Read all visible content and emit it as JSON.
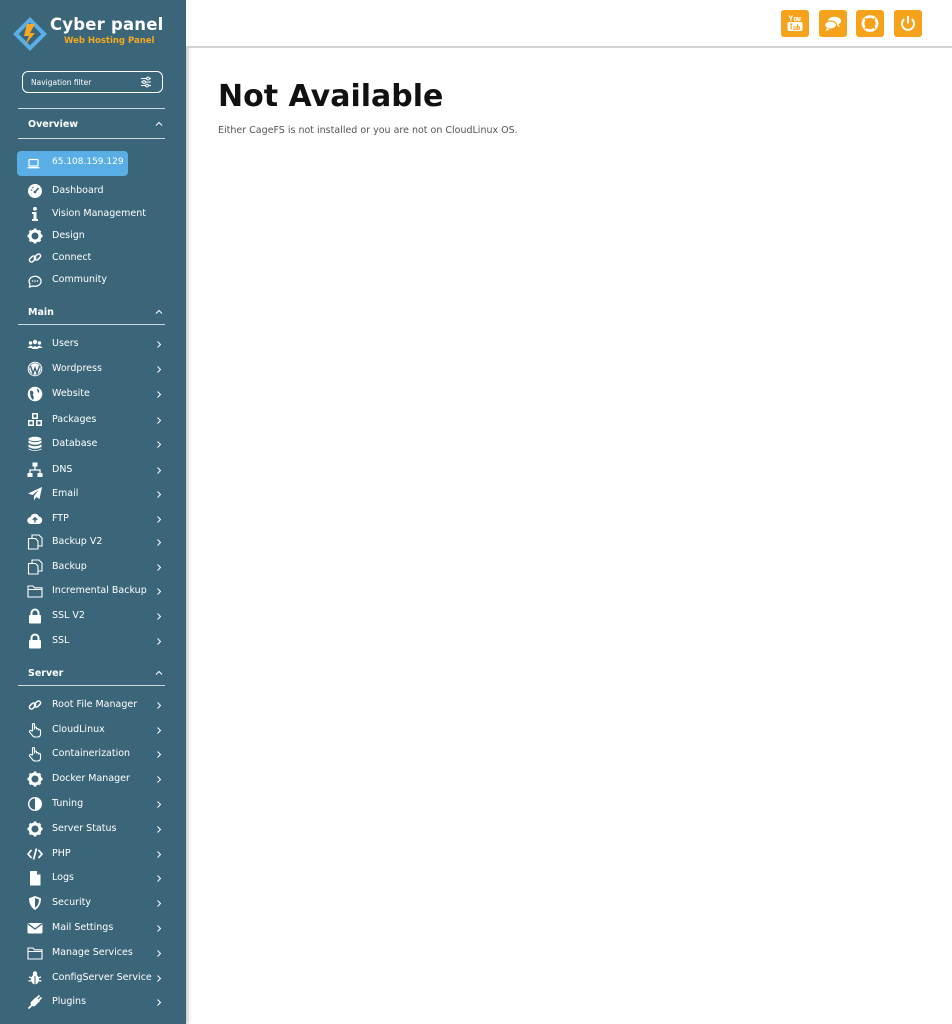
{
  "brand": {
    "name": "Cyber panel",
    "tagline": "Web Hosting Panel"
  },
  "nav_filter": {
    "placeholder": "Navigation filter"
  },
  "sections": {
    "overview": "Overview",
    "main": "Main",
    "server": "Server"
  },
  "server_ip": "65.108.159.129",
  "overview_items": [
    "Dashboard",
    "Vision Management",
    "Design",
    "Connect",
    "Community"
  ],
  "main_items": [
    "Users",
    "Wordpress",
    "Website",
    "Packages",
    "Database",
    "DNS",
    "Email",
    "FTP",
    "Backup V2",
    "Backup",
    "Incremental Backup",
    "SSL V2",
    "SSL"
  ],
  "server_items": [
    "Root File Manager",
    "CloudLinux",
    "Containerization",
    "Docker Manager",
    "Tuning",
    "Server Status",
    "PHP",
    "Logs",
    "Security",
    "Mail Settings",
    "Manage Services",
    "ConfigServer Service",
    "Plugins"
  ],
  "topbar": {
    "buttons": [
      "youtube-icon",
      "chat-icon",
      "lifebuoy-icon",
      "power-icon"
    ]
  },
  "content": {
    "title": "Not Available",
    "message": "Either CageFS is not installed or you are not on CloudLinux OS."
  },
  "colors": {
    "sidebar": "#3b6679",
    "accent": "#f7a21b",
    "ip_badge": "#5aaee6",
    "brand_tag": "#f6a821"
  }
}
